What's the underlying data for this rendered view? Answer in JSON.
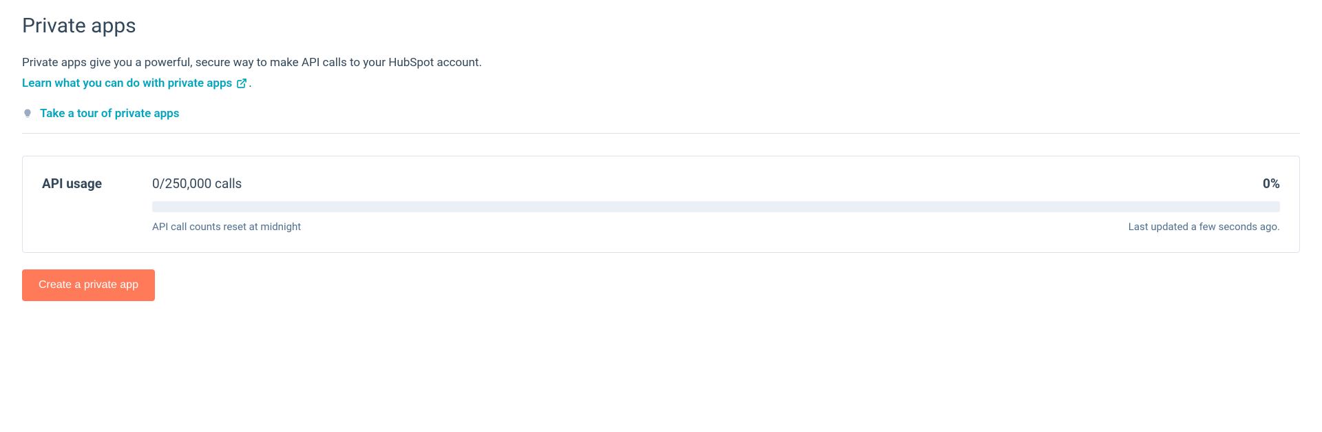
{
  "page": {
    "title": "Private apps",
    "description": "Private apps give you a powerful, secure way to make API calls to your HubSpot account.",
    "learn_more": "Learn what you can do with private apps",
    "period": ".",
    "tour_link": "Take a tour of private apps"
  },
  "usage": {
    "title": "API usage",
    "calls": "0/250,000 calls",
    "percent": "0%",
    "reset_note": "API call counts reset at midnight",
    "last_updated": "Last updated a few seconds ago."
  },
  "actions": {
    "create_button": "Create a private app"
  },
  "colors": {
    "link": "#00a4bd",
    "primary_button": "#ff7a59",
    "text": "#33475b",
    "muted": "#516f90",
    "border": "#dfe3eb",
    "progress_bg": "#eaf0f6"
  }
}
